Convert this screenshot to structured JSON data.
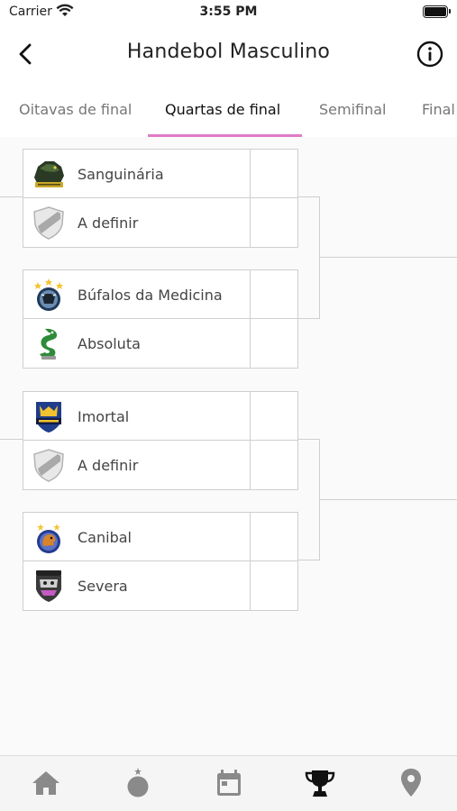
{
  "status_bar": {
    "carrier": "Carrier",
    "time": "3:55 PM"
  },
  "header": {
    "title": "Handebol Masculino"
  },
  "tabs": [
    {
      "label": "Oitavas de final",
      "active": false
    },
    {
      "label": "Quartas de final",
      "active": true
    },
    {
      "label": "Semifinal",
      "active": false
    },
    {
      "label": "Final",
      "active": false
    }
  ],
  "matches": [
    {
      "home": {
        "name": "Sanguinária",
        "logo": "sanguinaria-logo-icon",
        "score": ""
      },
      "away": {
        "name": "A definir",
        "logo": "placeholder-shield-icon",
        "score": ""
      }
    },
    {
      "home": {
        "name": "Búfalos da Medicina",
        "logo": "bufalos-logo-icon",
        "score": ""
      },
      "away": {
        "name": "Absoluta",
        "logo": "absoluta-logo-icon",
        "score": ""
      }
    },
    {
      "home": {
        "name": "Imortal",
        "logo": "imortal-logo-icon",
        "score": ""
      },
      "away": {
        "name": "A definir",
        "logo": "placeholder-shield-icon",
        "score": ""
      }
    },
    {
      "home": {
        "name": "Canibal",
        "logo": "canibal-logo-icon",
        "score": ""
      },
      "away": {
        "name": "Severa",
        "logo": "severa-logo-icon",
        "score": ""
      }
    }
  ],
  "bottom_nav": [
    {
      "icon": "home-icon",
      "active": false
    },
    {
      "icon": "ball-icon",
      "active": false
    },
    {
      "icon": "calendar-icon",
      "active": false
    },
    {
      "icon": "trophy-icon",
      "active": true
    },
    {
      "icon": "location-pin-icon",
      "active": false
    }
  ],
  "colors": {
    "accent": "#e07ac8",
    "active_icon": "#111111",
    "inactive_icon": "#8a8a8a"
  }
}
